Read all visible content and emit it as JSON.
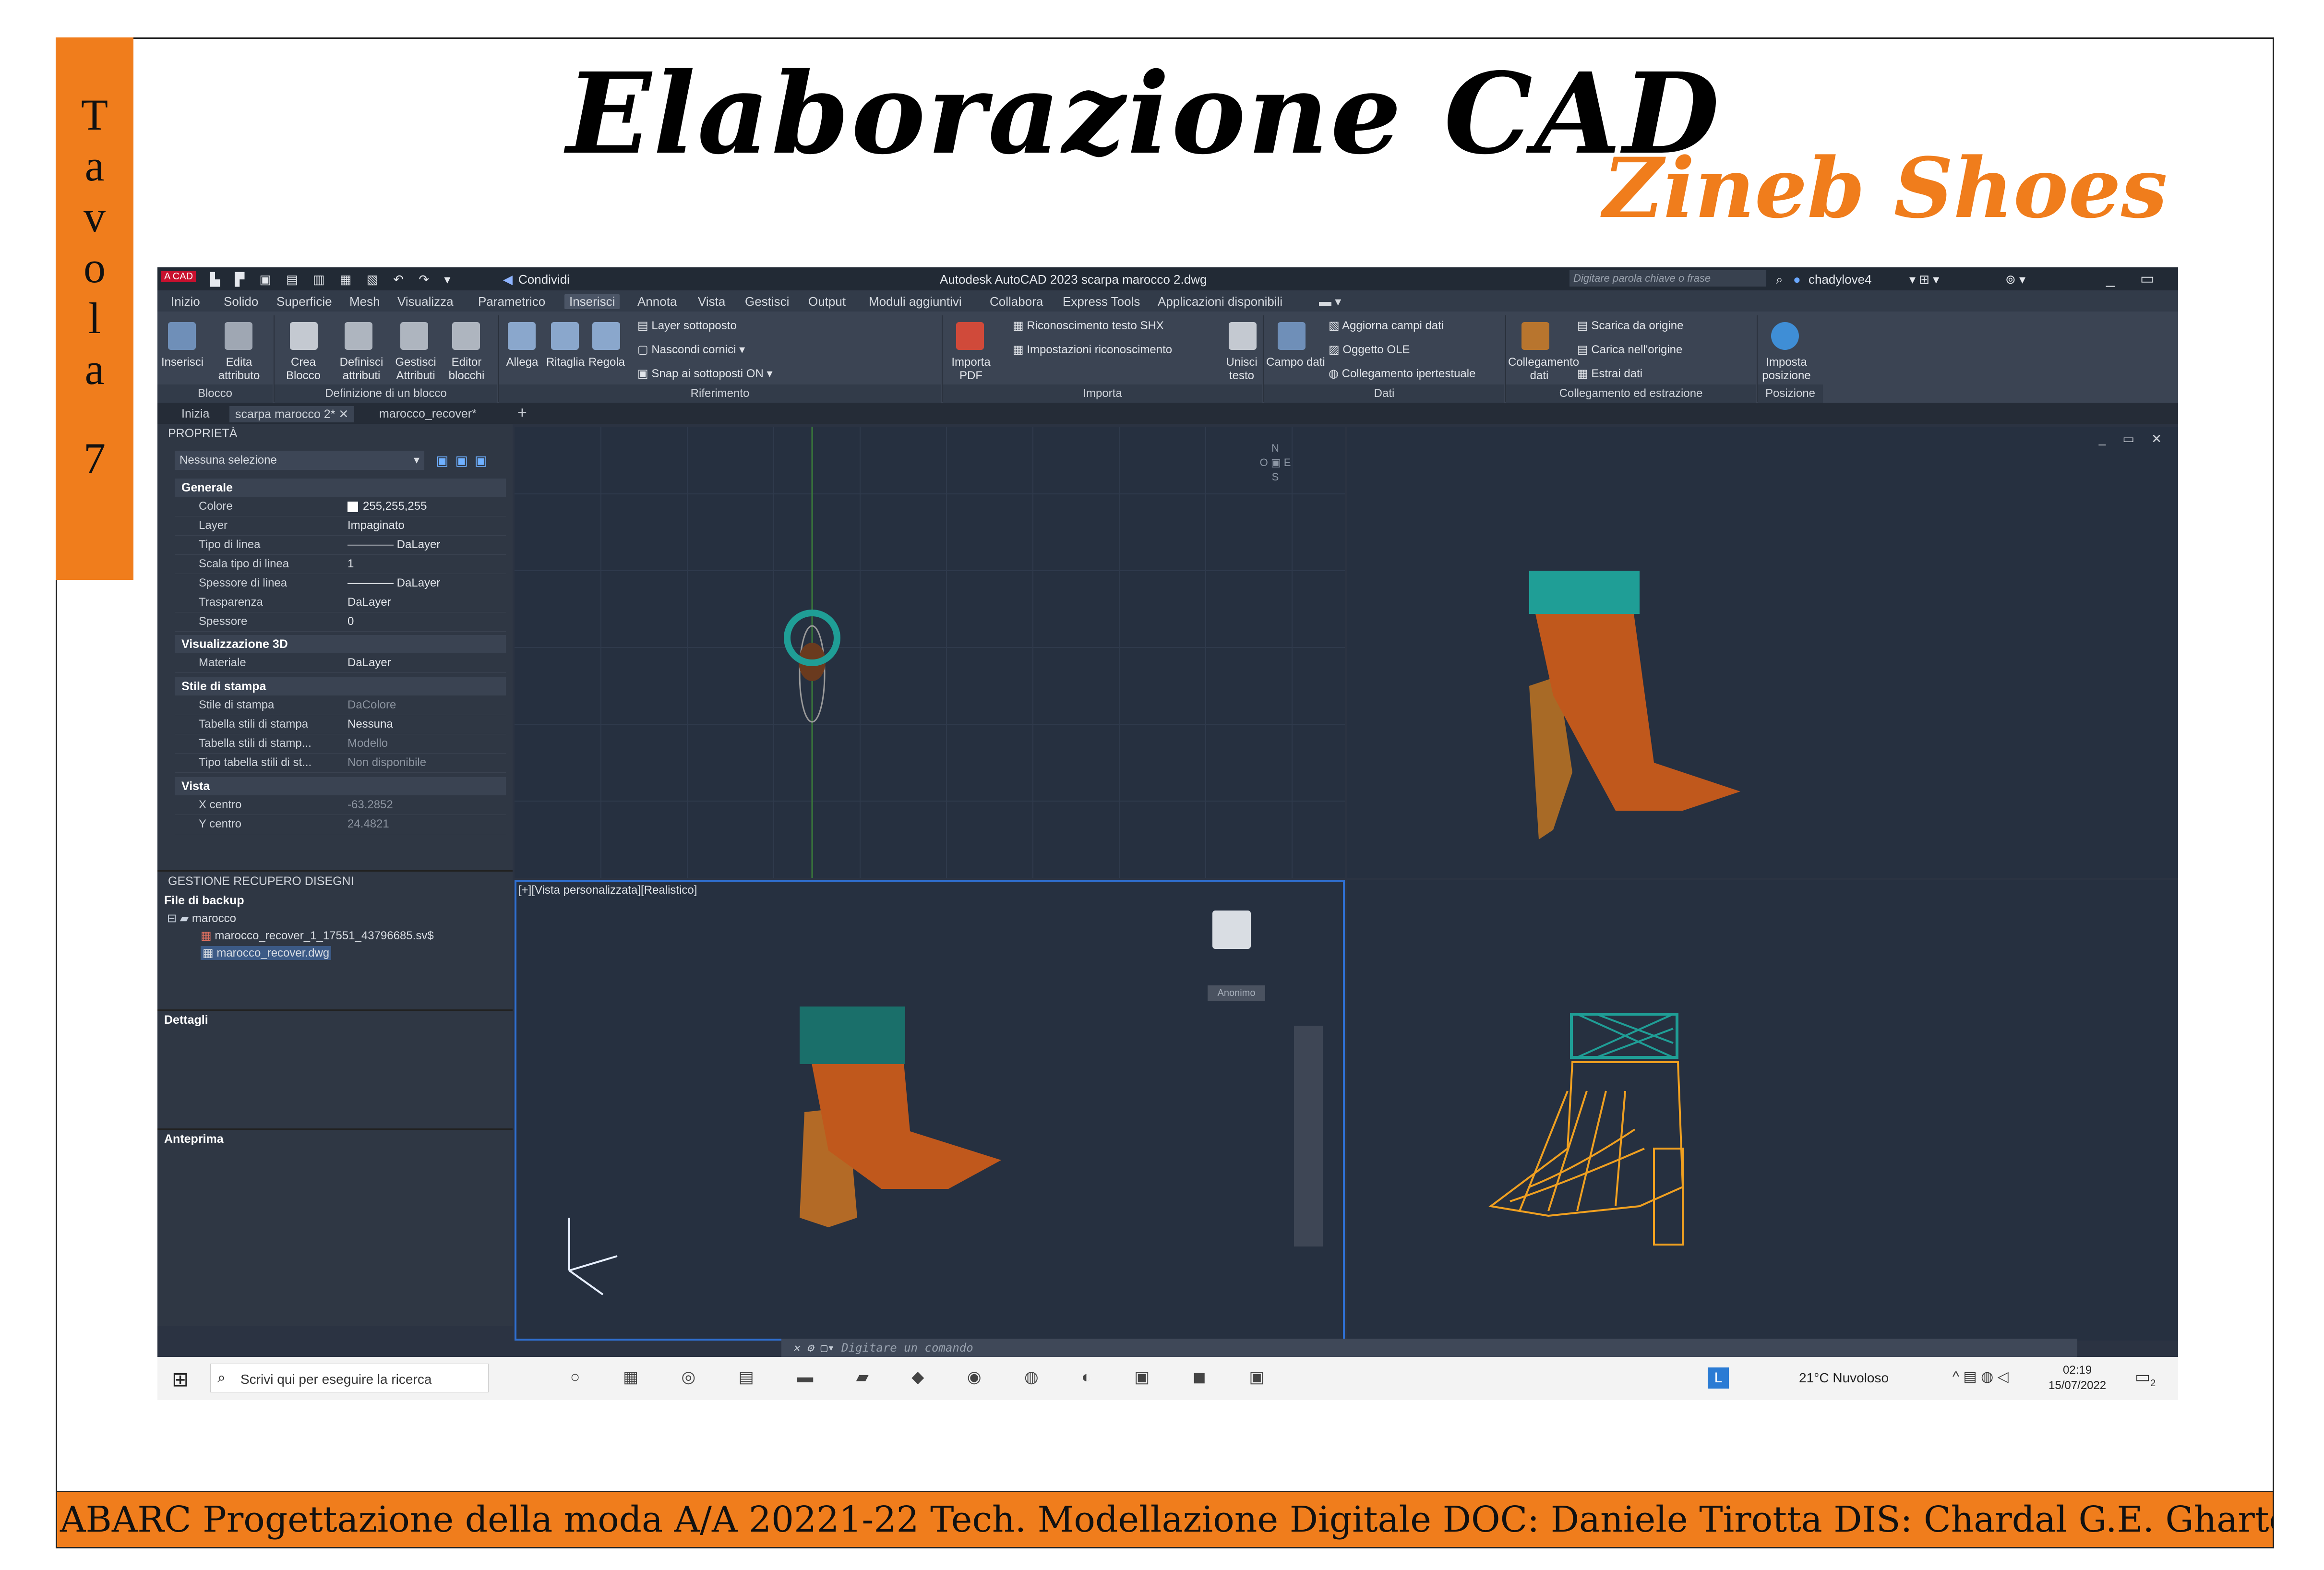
{
  "sheet": {
    "tavola_letters": [
      "T",
      "a",
      "v",
      "o",
      "l",
      "a"
    ],
    "tavola_number": "7",
    "title": "Elaborazione CAD",
    "subtitle": "Zineb Shoes",
    "footer": "ABARC Progettazione della moda A/A 20221-22 Tech. Modellazione Digitale DOC: Daniele Tirotta DIS: Chardal G.E. Ghartey",
    "colors": {
      "accent": "#f07d1c",
      "frame": "#222222"
    }
  },
  "autocad": {
    "app_badge": "A CAD",
    "share_label": "Condividi",
    "window_title": "Autodesk AutoCAD 2023   scarpa marocco 2.dwg",
    "search_placeholder": "Digitare parola chiave o frase",
    "user": "chadylove4",
    "menu": [
      "Inizio",
      "Solido",
      "Superficie",
      "Mesh",
      "Visualizza",
      "Parametrico",
      "Inserisci",
      "Annota",
      "Vista",
      "Gestisci",
      "Output",
      "Moduli aggiuntivi",
      "Collabora",
      "Express Tools",
      "Applicazioni disponibili"
    ],
    "active_menu": "Inserisci",
    "ribbon": {
      "blocco": {
        "group": "Blocco",
        "buttons": [
          "Inserisci",
          "Edita attributo"
        ]
      },
      "definizione": {
        "group": "Definizione di un blocco",
        "buttons": [
          "Crea Blocco",
          "Definisci attributi",
          "Gestisci Attributi",
          "Editor blocchi"
        ]
      },
      "riferimento": {
        "group": "Riferimento",
        "buttons": [
          "Allega",
          "Ritaglia",
          "Regola"
        ],
        "items": [
          "Layer sottoposto",
          "Nascondi cornici",
          "Snap ai sottoposti ON"
        ]
      },
      "importa_pdf": {
        "label": "Importa PDF"
      },
      "importa": {
        "group": "Importa",
        "items": [
          "Riconoscimento testo SHX",
          "Impostazioni riconoscimento"
        ],
        "button": "Unisci testo"
      },
      "dati": {
        "group": "Dati",
        "button": "Campo dati",
        "items": [
          "Aggiorna campi dati",
          "Oggetto OLE",
          "Collegamento ipertestuale"
        ]
      },
      "collegamento": {
        "group": "Collegamento ed estrazione",
        "button": "Collegamento dati",
        "items": [
          "Scarica da origine",
          "Carica nell'origine",
          "Estrai dati"
        ]
      },
      "posizione": {
        "group": "Posizione",
        "button": "Imposta posizione"
      }
    },
    "doc_tabs": [
      "Inizia",
      "scarpa marocco 2*",
      "marocco_recover*"
    ],
    "properties": {
      "header": "PROPRIETÀ",
      "selection": "Nessuna selezione",
      "sections": {
        "generale": {
          "title": "Generale",
          "rows": [
            {
              "k": "Colore",
              "v": "255,255,255"
            },
            {
              "k": "Layer",
              "v": "Impaginato"
            },
            {
              "k": "Tipo di linea",
              "v": "———— DaLayer"
            },
            {
              "k": "Scala tipo di linea",
              "v": "1"
            },
            {
              "k": "Spessore di linea",
              "v": "———— DaLayer"
            },
            {
              "k": "Trasparenza",
              "v": "DaLayer"
            },
            {
              "k": "Spessore",
              "v": "0"
            }
          ]
        },
        "vis3d": {
          "title": "Visualizzazione 3D",
          "rows": [
            {
              "k": "Materiale",
              "v": "DaLayer"
            }
          ]
        },
        "stile": {
          "title": "Stile di stampa",
          "rows": [
            {
              "k": "Stile di stampa",
              "v": "DaColore"
            },
            {
              "k": "Tabella stili di stampa",
              "v": "Nessuna"
            },
            {
              "k": "Tabella stili di stamp...",
              "v": "Modello"
            },
            {
              "k": "Tipo tabella stili di st...",
              "v": "Non disponibile"
            }
          ]
        },
        "vista": {
          "title": "Vista",
          "rows": [
            {
              "k": "X centro",
              "v": "-63.2852"
            },
            {
              "k": "Y centro",
              "v": "24.4821"
            }
          ]
        }
      }
    },
    "recovery": {
      "header": "GESTIONE RECUPERO DISEGNI",
      "backup_title": "File di backup",
      "folder": "marocco",
      "files": [
        "marocco_recover_1_17551_43796685.sv$",
        "marocco_recover.dwg"
      ],
      "details_title": "Dettagli",
      "preview_title": "Anteprima"
    },
    "viewport_label": "[+][Vista personalizzata][Realistico]",
    "viewcube": {
      "n": "N",
      "s": "S",
      "e": "E",
      "o": "O",
      "unnamed": "Anonimo"
    },
    "command_placeholder": "Digitare un comando",
    "model_colors": {
      "strap": "#1f9e96",
      "upper": "#c0581c",
      "heel": "#b46a22",
      "wire": "#f0a020"
    }
  },
  "taskbar": {
    "search": "Scrivi qui per eseguire la ricerca",
    "weather": "21°C  Nuvoloso",
    "time": "02:19",
    "date": "15/07/2022",
    "notifications": "2"
  }
}
